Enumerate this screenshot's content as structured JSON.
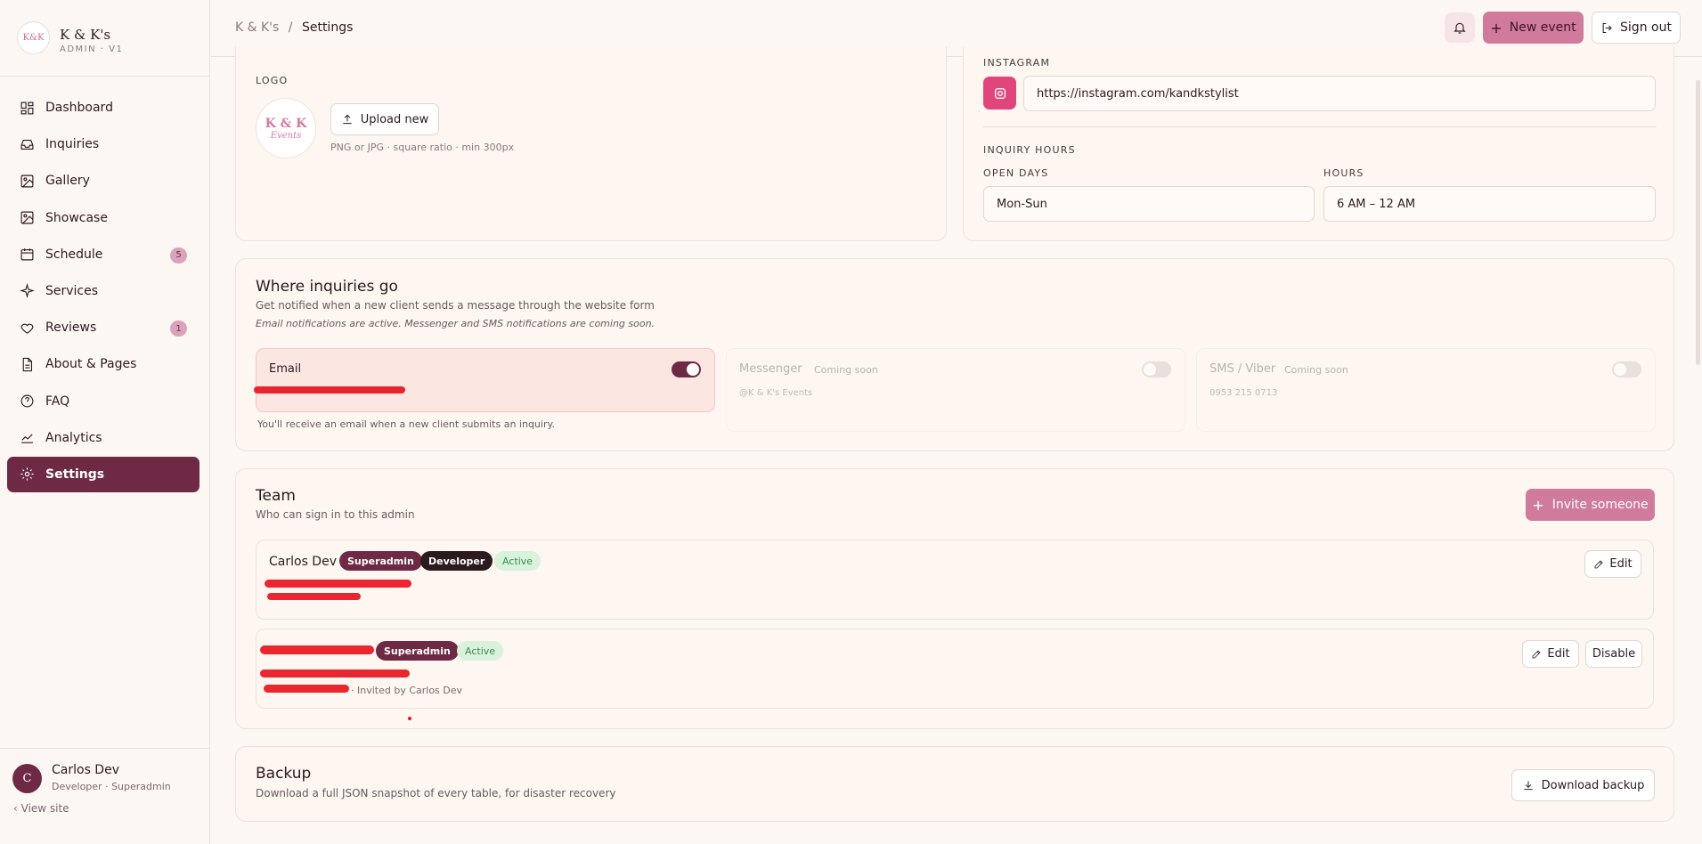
{
  "brand": {
    "logo_text": "K&K",
    "name": "K & K's",
    "sub": "ADMIN · V1"
  },
  "sidebar": {
    "items": [
      {
        "label": "Dashboard",
        "icon": "dashboard-icon"
      },
      {
        "label": "Inquiries",
        "icon": "inbox-icon"
      },
      {
        "label": "Gallery",
        "icon": "image-icon"
      },
      {
        "label": "Showcase",
        "icon": "image-icon"
      },
      {
        "label": "Schedule",
        "icon": "calendar-icon",
        "badge": "5"
      },
      {
        "label": "Services",
        "icon": "sparkle-icon"
      },
      {
        "label": "Reviews",
        "icon": "heart-icon",
        "badge": "1"
      },
      {
        "label": "About & Pages",
        "icon": "document-icon"
      },
      {
        "label": "FAQ",
        "icon": "help-circle-icon"
      },
      {
        "label": "Analytics",
        "icon": "chart-line-icon"
      },
      {
        "label": "Settings",
        "icon": "gear-icon",
        "active": true
      }
    ]
  },
  "user": {
    "initial": "C",
    "name": "Carlos Dev",
    "role": "Developer · Superadmin",
    "view_site": "View site"
  },
  "header": {
    "breadcrumb_root": "K & K's",
    "breadcrumb_sep": "/",
    "breadcrumb_current": "Settings",
    "new_event": "New event",
    "sign_out": "Sign out"
  },
  "logo_section": {
    "label": "LOGO",
    "upload": "Upload new",
    "hint": "PNG or JPG · square ratio · min 300px",
    "logo_line1": "K & K",
    "logo_line2": "Events"
  },
  "social": {
    "instagram_label": "INSTAGRAM",
    "instagram_url": "https://instagram.com/kandkstylist"
  },
  "hours": {
    "title": "INQUIRY HOURS",
    "days_label": "OPEN DAYS",
    "days_value": "Mon-Sun",
    "hours_label": "HOURS",
    "hours_value": "6 AM – 12 AM"
  },
  "inquiries": {
    "title": "Where inquiries go",
    "subtitle": "Get notified when a new client sends a message through the website form",
    "note": "Email notifications are active. Messenger and SMS notifications are coming soon.",
    "email": {
      "label": "Email",
      "on": true,
      "help": "You'll receive an email when a new client submits an inquiry."
    },
    "messenger": {
      "label": "Messenger",
      "tag": "Coming soon",
      "detail": "@K & K's Events",
      "on": false
    },
    "sms": {
      "label": "SMS / Viber",
      "tag": "Coming soon",
      "detail": "0953 215 0713",
      "on": false
    }
  },
  "team": {
    "title": "Team",
    "subtitle": "Who can sign in to this admin",
    "invite": "Invite someone",
    "members": [
      {
        "name": "Carlos Dev",
        "roles": [
          "Superadmin",
          "Developer"
        ],
        "status": "Active",
        "edit": "Edit"
      },
      {
        "roles": [
          "Superadmin"
        ],
        "status": "Active",
        "invited_by": "· Invited by Carlos Dev",
        "edit": "Edit",
        "disable": "Disable"
      }
    ]
  },
  "backup": {
    "title": "Backup",
    "subtitle": "Download a full JSON snapshot of every table, for disaster recovery",
    "button": "Download backup"
  },
  "colors": {
    "accent": "#6e2a45",
    "pink": "#d07a9c",
    "active_green": "#d8f2dc",
    "instagram": "#e0457b"
  }
}
